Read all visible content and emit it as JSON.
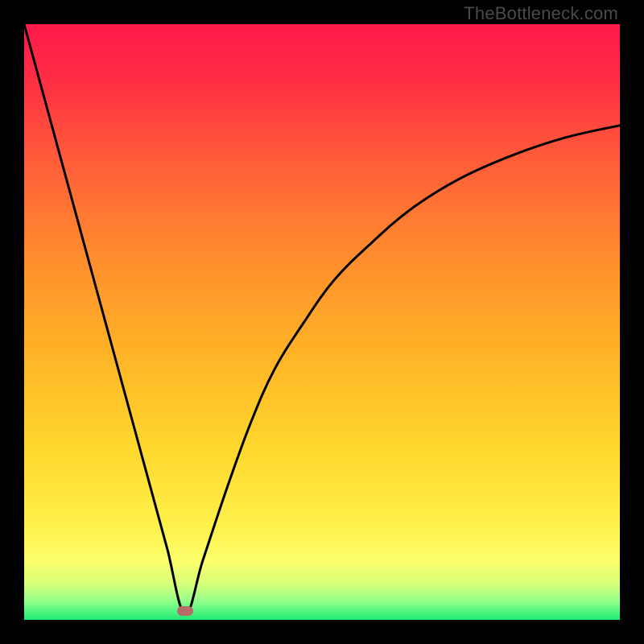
{
  "watermark": "TheBottleneck.com",
  "colors": {
    "gradient_top": "#ff1744",
    "gradient_mid": "#ffb300",
    "gradient_low": "#ffee58",
    "gradient_bottom": "#00e676",
    "curve": "#000000",
    "marker": "#b86b6b",
    "frame": "#000000"
  },
  "chart_data": {
    "type": "line",
    "title": "",
    "xlabel": "",
    "ylabel": "",
    "xlim": [
      0,
      100
    ],
    "ylim": [
      0,
      100
    ],
    "optimum_x": 27,
    "marker": {
      "x": 27,
      "y": 1.5
    },
    "series": [
      {
        "name": "bottleneck-curve",
        "x": [
          0,
          3,
          6,
          9,
          12,
          15,
          18,
          21,
          24,
          27,
          30,
          34,
          38,
          42,
          47,
          52,
          58,
          65,
          73,
          82,
          91,
          100
        ],
        "y": [
          100,
          89,
          78,
          67,
          56,
          45,
          34,
          23,
          12,
          1,
          10,
          22,
          33,
          42,
          50,
          57,
          63,
          69,
          74,
          78,
          81,
          83
        ]
      }
    ]
  }
}
